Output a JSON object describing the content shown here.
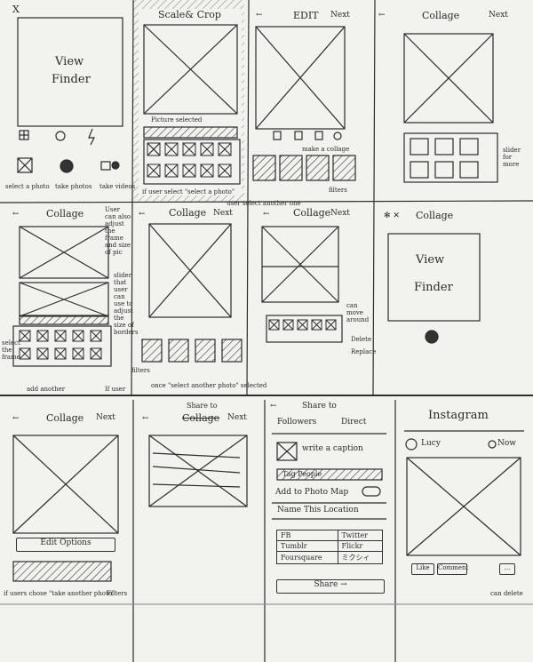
{
  "row1": {
    "frame1": {
      "close": "X",
      "viewfinder": [
        "View",
        "Finder"
      ],
      "captions": {
        "select": "select a photo",
        "take": "take photos",
        "video": "take videos"
      }
    },
    "frame2": {
      "title": "Scale& Crop",
      "picture_selected": "Picture selected",
      "note": "if user select \"select a photo\""
    },
    "frame3": {
      "title": "EDIT",
      "next": "Next",
      "make_collage": "make a collage",
      "filters": "filters"
    },
    "frame4": {
      "title": "Collage",
      "next": "Next",
      "side_note": "slider for more"
    }
  },
  "row2": {
    "frame1": {
      "title": "Collage",
      "side_note_top": "User can also adjust the frame and size of pic",
      "slider_note": "slider that user can use to adjust the size of borders",
      "side_left": "select the frame",
      "bottom_left": "add another",
      "bottom_right": "If user"
    },
    "frame2": {
      "title": "Collage",
      "next": "Next",
      "filters": "filters",
      "once_note": "once \"select another photo\" selected"
    },
    "frame3": {
      "title": "Collage",
      "next": "Next",
      "top_note": "user select another one",
      "move_note": "can move around",
      "delete_label": "Delete",
      "replace_label": "Replace"
    },
    "frame4": {
      "title": "Collage",
      "viewfinder": [
        "View",
        "Finder"
      ]
    }
  },
  "row3": {
    "frame1": {
      "title": "Collage",
      "next": "Next",
      "edit_options": "Edit Options",
      "note": "if users chose \"take another photo\"",
      "filters": "Filters"
    },
    "frame2": {
      "header": "Share to",
      "title": "Collage",
      "next": "Next"
    },
    "frame3": {
      "title": "Share to",
      "tabs": [
        "Followers",
        "Direct"
      ],
      "caption": "write a caption",
      "tag": "Tag People",
      "photo_map": "Add to Photo Map",
      "location": "Name This Location",
      "networks": [
        [
          "FB",
          "Twitter"
        ],
        [
          "Tumblr",
          "Flickr"
        ],
        [
          "Foursquare",
          "ミクシィ"
        ]
      ],
      "share": "Share →"
    },
    "frame4": {
      "title": "Instagram",
      "user": "Lucy",
      "time": "Now",
      "like": "Like",
      "comment": "Comment",
      "more": "...",
      "delete_note": "can delete"
    }
  }
}
